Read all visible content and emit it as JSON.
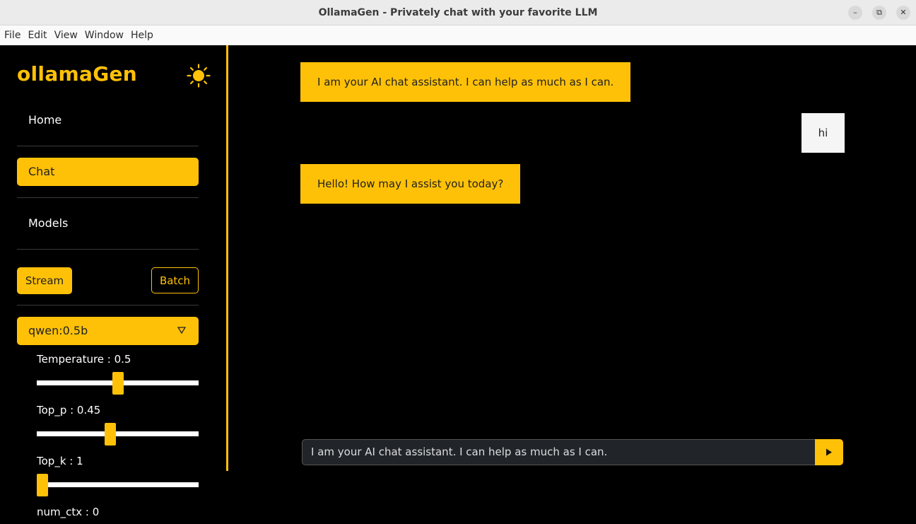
{
  "window": {
    "title": "OllamaGen - Privately chat with your favorite LLM",
    "controls": [
      "minimize-icon",
      "maximize-icon",
      "close-icon"
    ]
  },
  "menu": [
    "File",
    "Edit",
    "View",
    "Window",
    "Help"
  ],
  "sidebar": {
    "logo": "ollamaGen",
    "theme_icon": "sun-icon",
    "nav": [
      {
        "label": "Home",
        "active": false
      },
      {
        "label": "Chat",
        "active": true
      },
      {
        "label": "Models",
        "active": false
      }
    ],
    "mode_buttons": {
      "stream": "Stream",
      "batch": "Batch",
      "selected": "Stream"
    },
    "model_select": {
      "value": "qwen:0.5b"
    },
    "params": [
      {
        "label": "Temperature : 0.5",
        "value": 0.5
      },
      {
        "label": "Top_p : 0.45",
        "value": 0.45
      },
      {
        "label": "Top_k : 1",
        "value": 1
      },
      {
        "label": "num_ctx : 0",
        "value": 0
      }
    ]
  },
  "chat": {
    "messages": [
      {
        "role": "assistant",
        "text": "I am your AI chat assistant. I can help as much as I can."
      },
      {
        "role": "user",
        "text": "hi"
      },
      {
        "role": "assistant",
        "text": "Hello! How may I assist you today?"
      }
    ],
    "input": {
      "value": "I am your AI chat assistant. I can help as much as I can."
    },
    "send_icon": "play-icon"
  },
  "colors": {
    "accent": "#ffc107",
    "background": "#000000",
    "input_bg": "#212529"
  }
}
